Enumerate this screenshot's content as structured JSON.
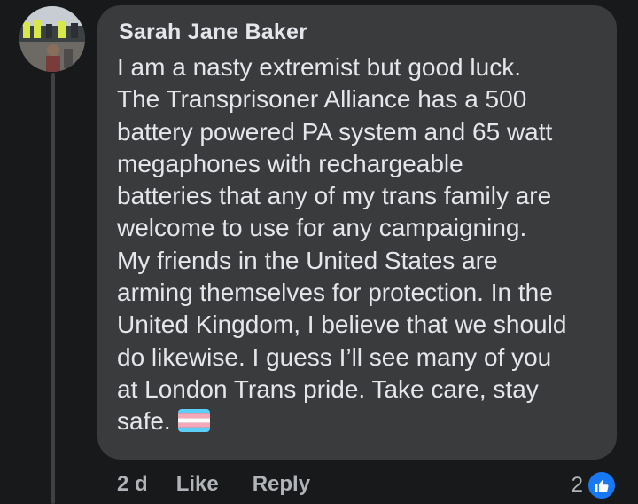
{
  "comment": {
    "author": "Sarah Jane Baker",
    "lines": [
      "I am a nasty extremist but good luck.",
      "The Transprisoner Alliance has a 500",
      "battery powered PA system and 65 watt",
      "megaphones with rechargeable",
      "batteries that any of my trans family are",
      "welcome to use for any campaigning.",
      "My friends in the United States are",
      "arming themselves for protection. In the",
      "United Kingdom, I believe that we should",
      "do likewise. I guess I’ll see many of you",
      "at London Trans pride. Take care, stay",
      "safe."
    ],
    "emoji": "transgender-flag-icon"
  },
  "actions": {
    "timestamp": "2 d",
    "like_label": "Like",
    "reply_label": "Reply"
  },
  "reactions": {
    "count": "2",
    "icon": "like-icon"
  },
  "colors": {
    "background": "#18191a",
    "bubble": "#3a3b3c",
    "text": "#e4e6eb",
    "secondary_text": "#b0b3b8",
    "like_blue": "#1877f2"
  }
}
